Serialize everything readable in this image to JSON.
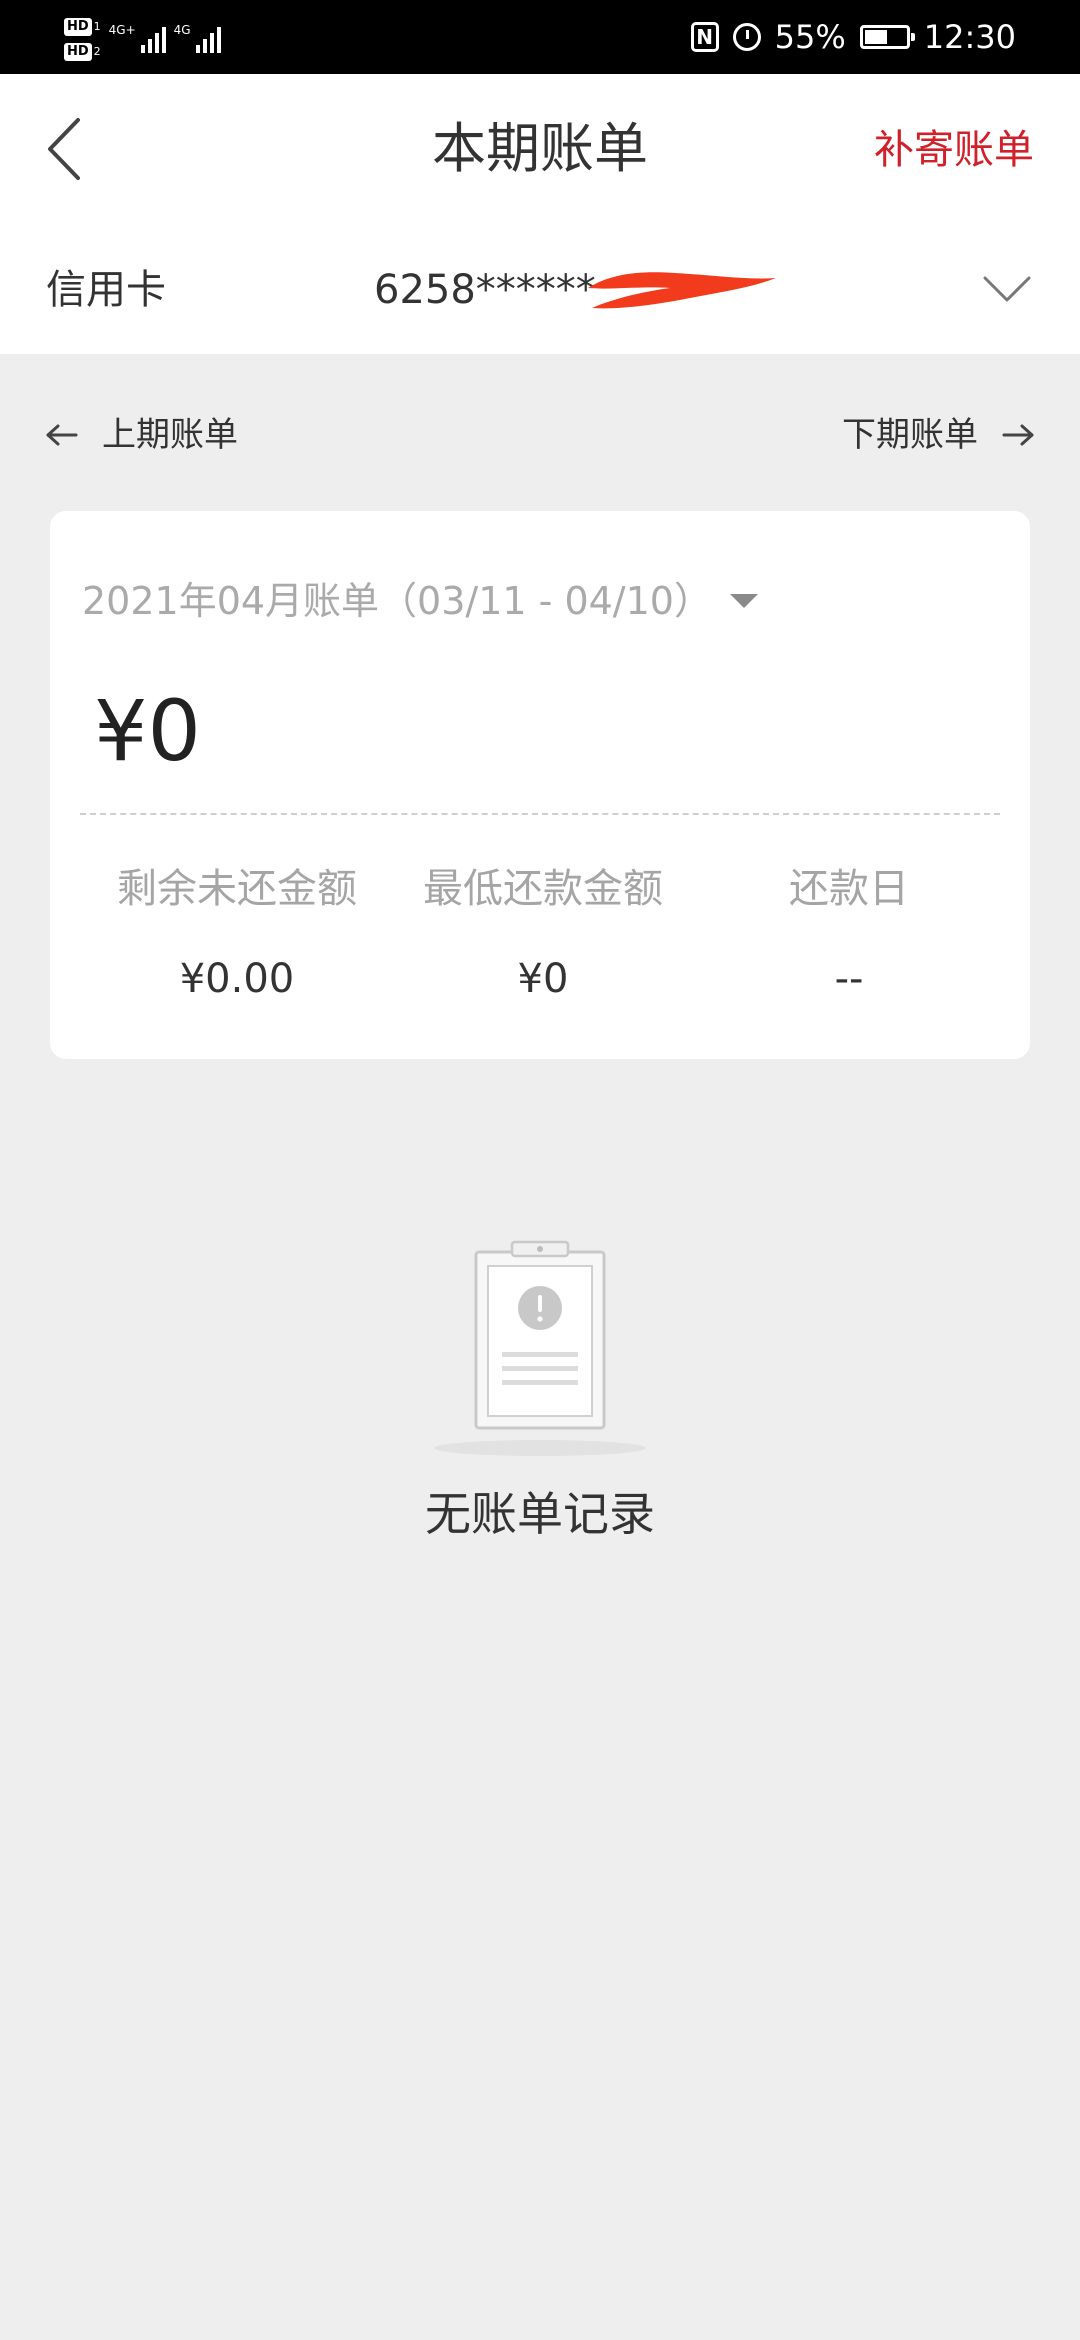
{
  "status_bar": {
    "hd_label": "HD",
    "sim1": "1",
    "sim2": "2",
    "network1": "4G+",
    "network2": "4G",
    "battery_percent": "55%",
    "battery_level": 0.55,
    "time": "12:30",
    "nfc_label": "N",
    "icons": [
      "hd-icon",
      "signal-icon",
      "nfc-icon",
      "alarm-icon",
      "battery-icon"
    ]
  },
  "header": {
    "title": "本期账单",
    "back_icon": "chevron-left-icon",
    "reissue_label": "补寄账单",
    "accent_color": "#d0202a"
  },
  "card_selector": {
    "label": "信用卡",
    "card_number": "6258******",
    "dropdown_icon": "chevron-down-icon"
  },
  "period_nav": {
    "prev_label": "上期账单",
    "next_label": "下期账单",
    "prev_icon": "arrow-left-icon",
    "next_icon": "arrow-right-icon"
  },
  "bill": {
    "period_text": "2021年04月账单（03/11 - 04/10）",
    "amount": "¥0",
    "stats": [
      {
        "label": "剩余未还金额",
        "value": "¥0.00"
      },
      {
        "label": "最低还款金额",
        "value": "¥0"
      },
      {
        "label": "还款日",
        "value": "--"
      }
    ]
  },
  "empty_state": {
    "icon": "empty-clipboard-icon",
    "text": "无账单记录"
  }
}
